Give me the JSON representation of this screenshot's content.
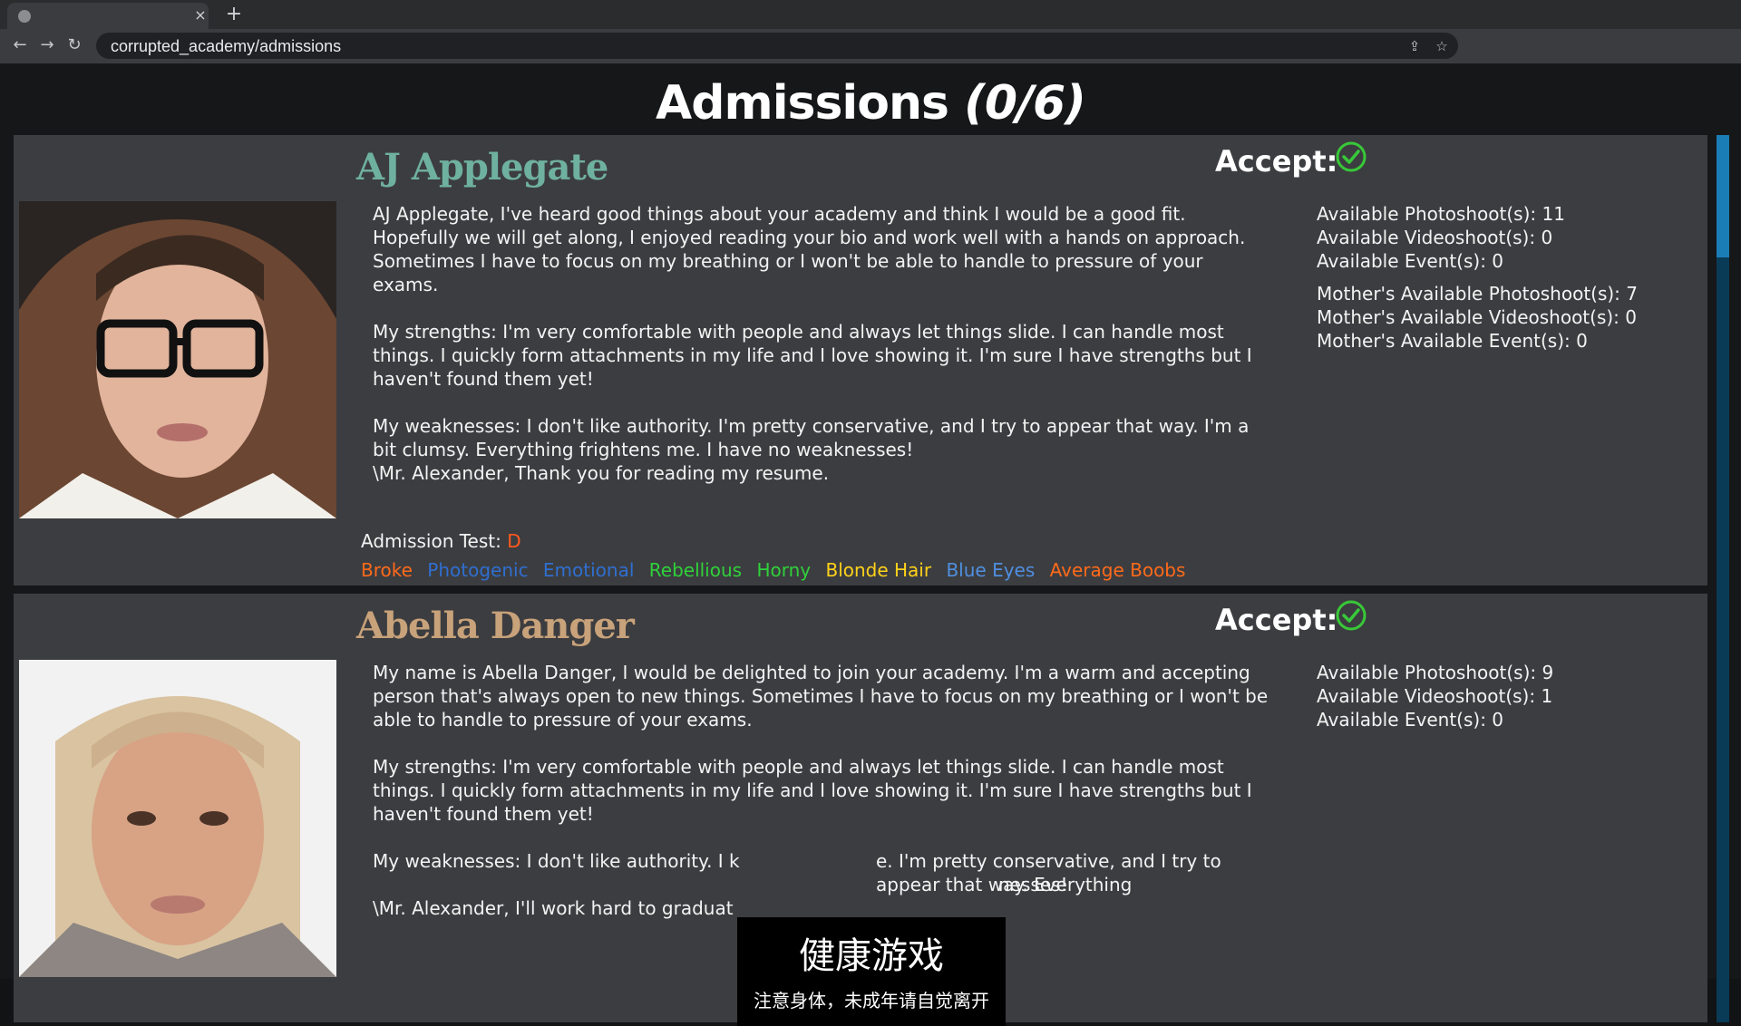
{
  "browser": {
    "url": "corrupted_academy/admissions",
    "close_label": "×",
    "newtab_label": "+",
    "back_label": "←",
    "forward_label": "→",
    "reload_label": "↻",
    "share_label": "⇪",
    "star_label": "☆"
  },
  "page": {
    "title": "Admissions",
    "count": "(0/6)"
  },
  "cards": [
    {
      "name": "AJ Applegate",
      "name_color": "#6fb1a0",
      "accept_label": "Accept:",
      "description": [
        "AJ Applegate, I've heard good things about your academy and think I would be a good fit. Hopefully we will get along, I enjoyed reading your bio and work well with a hands on approach. Sometimes I have to focus on my breathing or I won't be able to handle to pressure of your exams.",
        "My strengths: I'm very comfortable with people and always let things slide. I can handle most things. I quickly form attachments in my life and I love showing it. I'm sure I have strengths but I haven't found them yet!",
        "My weaknesses: I don't like authority. I'm pretty conservative, and I try to appear that way. I'm a bit clumsy. Everything frightens me. I have no weaknesses!",
        "\\Mr. Alexander, Thank you for reading my resume."
      ],
      "stats": [
        "Available Photoshoot(s): 11",
        "Available Videoshoot(s): 0",
        "Available Event(s): 0"
      ],
      "mother_stats": [
        "Mother's Available Photoshoot(s): 7",
        "Mother's Available Videoshoot(s): 0",
        "Mother's Available Event(s): 0"
      ],
      "admission_test_label": "Admission Test:",
      "admission_test_grade": "D",
      "traits": [
        {
          "label": "Broke",
          "color": "#ff6a1a"
        },
        {
          "label": "Photogenic",
          "color": "#2f6fd0"
        },
        {
          "label": "Emotional",
          "color": "#2f6fd0"
        },
        {
          "label": "Rebellious",
          "color": "#2fd13a"
        },
        {
          "label": "Horny",
          "color": "#2fd13a"
        },
        {
          "label": "Blonde Hair",
          "color": "#ffd21a"
        },
        {
          "label": "Blue Eyes",
          "color": "#4f8fe0"
        },
        {
          "label": "Average Boobs",
          "color": "#ff6a1a"
        }
      ]
    },
    {
      "name": "Abella Danger",
      "name_color": "#c8a27a",
      "accept_label": "Accept:",
      "description": [
        "My name is Abella Danger, I would be delighted to join your academy. I'm a warm and accepting person that's always open to new things. Sometimes I have to focus on my breathing or I won't be able to handle to pressure of your exams.",
        "My strengths: I'm very comfortable with people and always let things slide. I can handle most things. I quickly form attachments in my life and I love showing it. I'm sure I have strengths but I haven't found them yet!",
        "My weaknesses: I don't like authority. I k",
        "e. I'm pretty conservative, and I try to appear that way. Everything",
        "nesses!",
        "\\Mr. Alexander, I'll work hard to graduat"
      ],
      "stats": [
        "Available Photoshoot(s): 9",
        "Available Videoshoot(s): 1",
        "Available Event(s): 0"
      ]
    }
  ],
  "overlay": {
    "title": "健康游戏",
    "subtitle": "注意身体，未成年请自觉离开"
  },
  "colors": {
    "accept_check": "#38c838",
    "scroll_track": "#0a3b56",
    "scroll_thumb": "#1b7db6"
  }
}
